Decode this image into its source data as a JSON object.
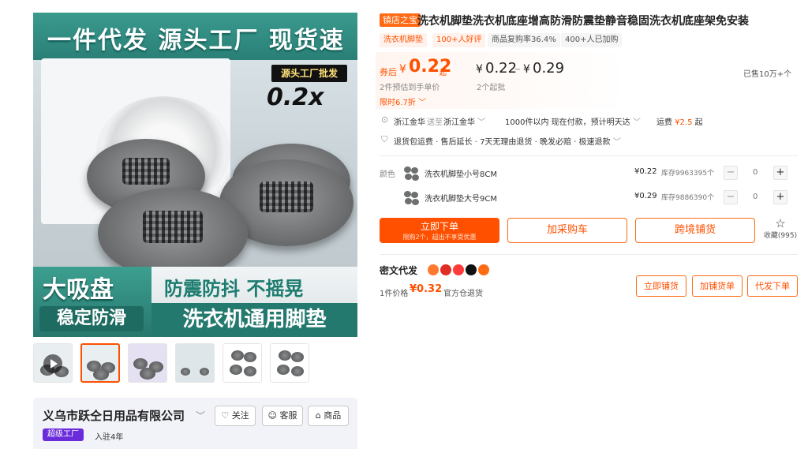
{
  "image": {
    "top_banner": "一件代发 源头工厂 现货速发",
    "factory_tag": "源头工厂批发",
    "price_tag": "0.2x",
    "bottom_left_1": "大吸盘",
    "bottom_left_2": "稳定防滑",
    "bottom_right_1": "防震防抖 不摇晃",
    "bottom_right_2": "洗衣机通用脚垫"
  },
  "company": {
    "name": "义乌市跃仝日用品有限公司",
    "badge": "超级工厂",
    "years": "入驻4年",
    "follow_label": "关注",
    "service_label": "客服",
    "shop_label": "商品"
  },
  "product": {
    "store_badge": "镇店之宝",
    "title": "洗衣机脚垫洗衣机底座增高防滑防震垫静音稳固洗衣机底座架免安装",
    "tags": [
      "洗衣机脚垫",
      "100+人好评",
      "商品复购率36.4%",
      "400+人已加购"
    ]
  },
  "price": {
    "coupon_label": "券后",
    "currency": "¥",
    "coupon_price": "0.22",
    "coupon_suffix": "起",
    "coupon_note": "2件预估到手单价",
    "range_low": "0.22",
    "range_sep": "~",
    "range_high": "0.29",
    "min_order": "2个起批",
    "sold": "已售10万+个",
    "limited": "限时6.7折"
  },
  "shipping": {
    "from": "浙江金华",
    "to_label": "送至",
    "to": "浙江金华",
    "stock_note": "1000件以内  现在付款，预计明天达",
    "fee_label": "运费",
    "fee": "¥2.5",
    "fee_suffix": "起",
    "guarantee": "退货包运费 · 售后延长 · 7天无理由退货 · 晚发必赔 · 极速退款"
  },
  "sku": {
    "label": "颜色",
    "items": [
      {
        "name": "洗衣机脚垫小号8CM",
        "price": "¥0.22",
        "stock": "库存9963395个",
        "qty": "0"
      },
      {
        "name": "洗衣机脚垫大号9CM",
        "price": "¥0.29",
        "stock": "库存9886390个",
        "qty": "0"
      }
    ],
    "minus": "−",
    "plus": "+"
  },
  "actions": {
    "order_label": "立即下单",
    "order_sub": "限购2个，超出不享受优惠",
    "cart_label": "加采购车",
    "cross_label": "跨境铺货",
    "fav_label": "收藏",
    "fav_count": "(995)"
  },
  "dropship": {
    "title": "密文代发",
    "price_label": "1件价格",
    "price": "¥0.32",
    "note": "官方仓退货",
    "btn1": "立即铺货",
    "btn2": "加铺货单",
    "btn3": "代发下单"
  },
  "colors": {
    "accent": "#ff5000",
    "teal": "#2a7f76",
    "purple": "#6a2bdb"
  }
}
